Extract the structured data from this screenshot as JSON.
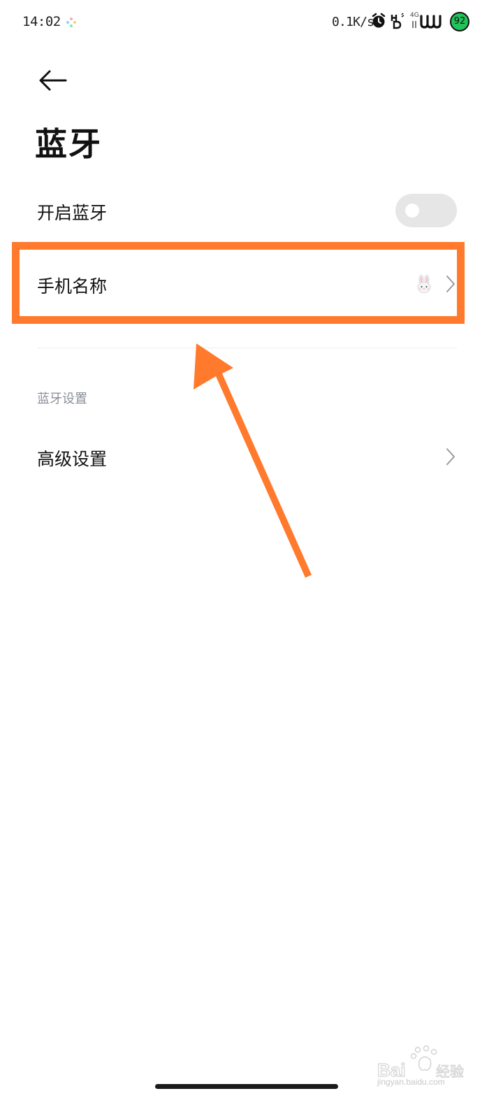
{
  "status_bar": {
    "time": "14:02",
    "net_speed": "0.1K/s",
    "battery_level": "92",
    "icons": [
      "app-dots-icon",
      "alarm-icon",
      "hd-icon",
      "signal-4g-icon",
      "wifi-icon",
      "battery-icon"
    ],
    "signal_label": "4G",
    "battery_color": "#21c35a"
  },
  "header": {
    "back_icon": "back-arrow-icon",
    "title": "蓝牙"
  },
  "settings": {
    "bluetooth_toggle": {
      "label": "开启蓝牙",
      "enabled": false
    },
    "phone_name": {
      "label": "手机名称",
      "value_icon": "rabbit-emoji",
      "chevron_icon": "chevron-right-icon"
    },
    "section_header": "蓝牙设置",
    "advanced": {
      "label": "高级设置",
      "chevron_icon": "chevron-right-icon"
    }
  },
  "annotation": {
    "highlight_color": "#ff7a2c",
    "arrow_color": "#ff7a2c"
  },
  "watermark": {
    "brand": "Bai du 经验",
    "domain": "jingyan.baidu.com"
  }
}
